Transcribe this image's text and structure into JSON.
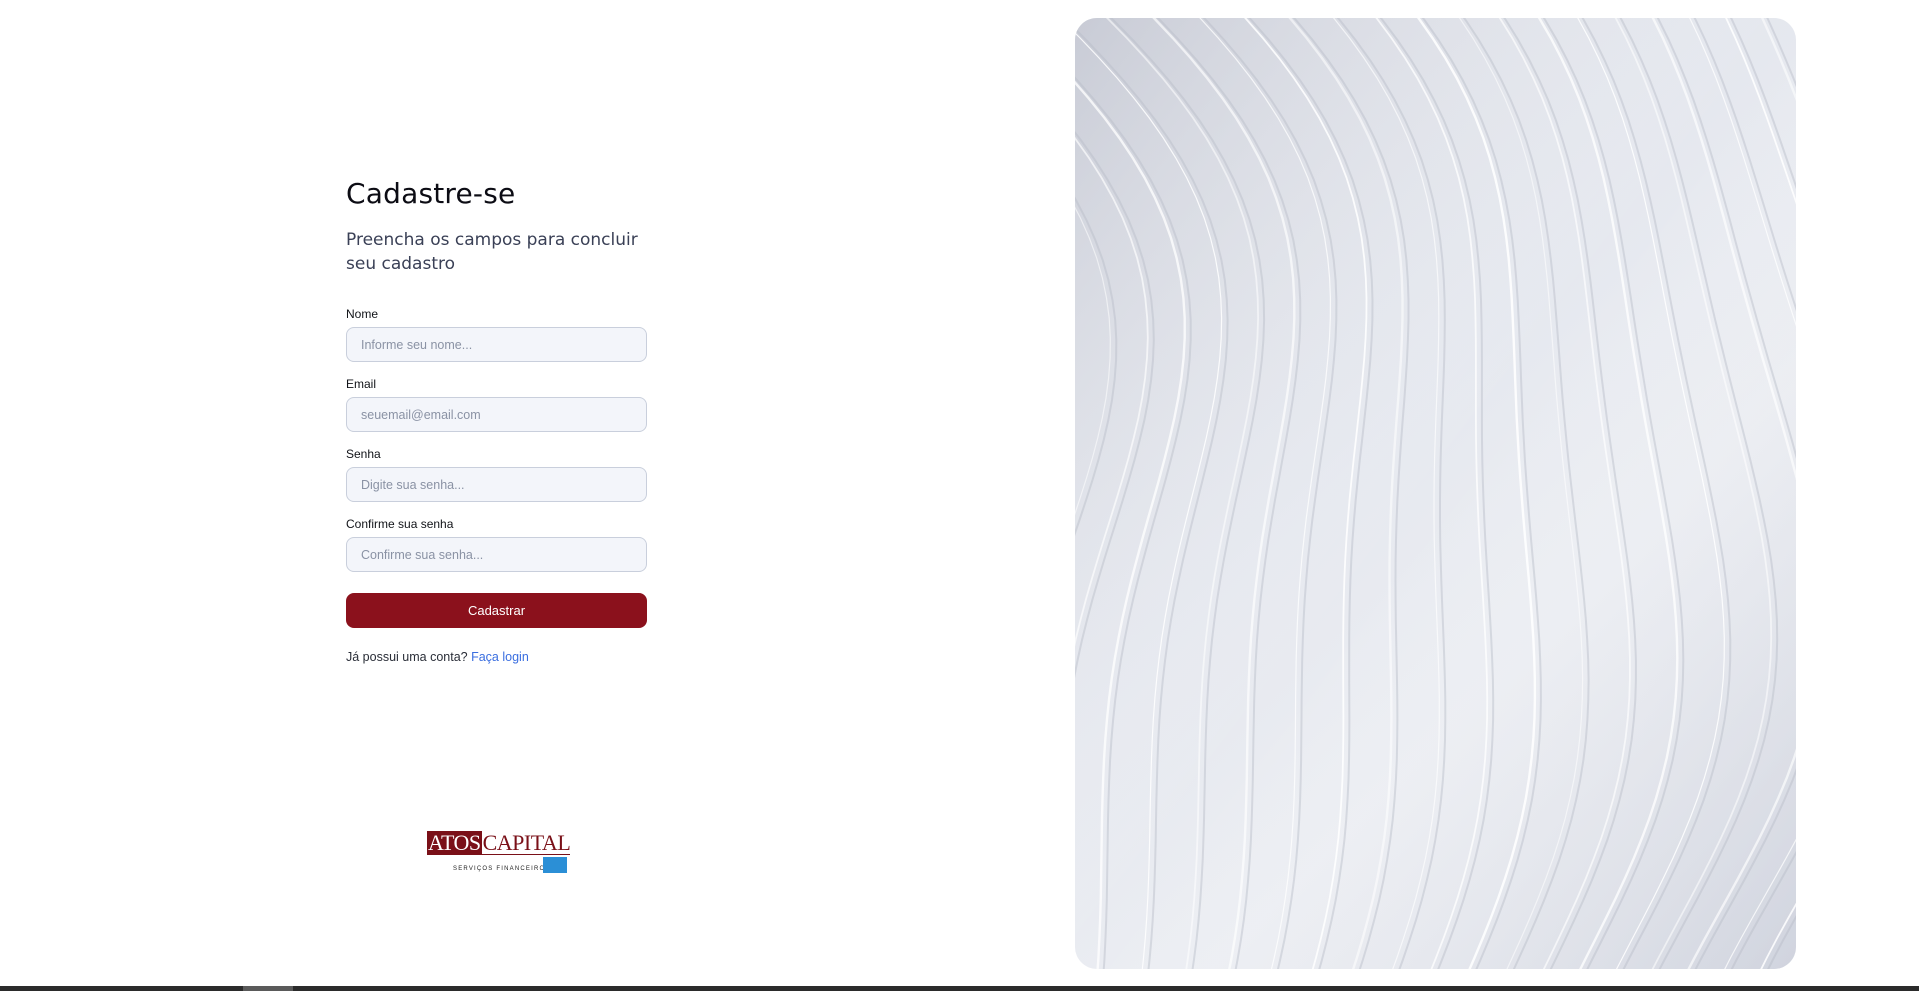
{
  "form": {
    "title": "Cadastre-se",
    "subtitle": "Preencha os campos para concluir seu cadastro",
    "fields": [
      {
        "label": "Nome",
        "placeholder": "Informe seu nome...",
        "value": ""
      },
      {
        "label": "Email",
        "placeholder": "seuemail@email.com",
        "value": ""
      },
      {
        "label": "Senha",
        "placeholder": "Digite sua senha...",
        "value": ""
      },
      {
        "label": "Confirme sua senha",
        "placeholder": "Confirme sua senha...",
        "value": ""
      }
    ],
    "submit_label": "Cadastrar",
    "login_prompt": "Já possui uma conta?",
    "login_link": "Faça login"
  },
  "logo": {
    "word_dark": "ATOS",
    "word_light": "CAPITAL",
    "tagline": "SERVIÇOS FINANCEIROS"
  },
  "colors": {
    "accent": "#8b111c",
    "link": "#3a6ee0",
    "input_bg": "#f3f5fa",
    "input_border": "#c9cfdc"
  },
  "icons": {
    "hero": "abstract-wave-lines-image"
  }
}
